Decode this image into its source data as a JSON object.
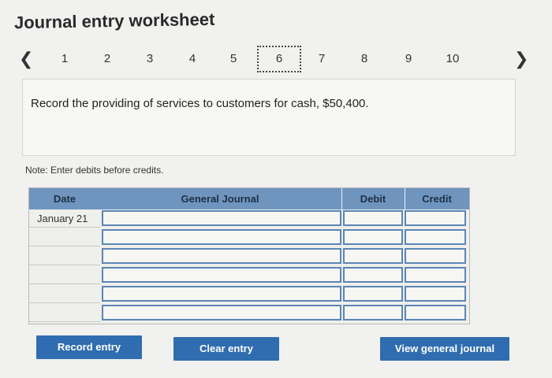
{
  "title": "Journal entry worksheet",
  "pager": {
    "prev_icon": "chevron-left-icon",
    "next_icon": "chevron-right-icon",
    "pages": [
      "1",
      "2",
      "3",
      "4",
      "5",
      "6",
      "7",
      "8",
      "9",
      "10"
    ],
    "active_page": "6"
  },
  "question": "Record the providing of services to customers for cash, $50,400.",
  "note": "Note: Enter debits before credits.",
  "journal": {
    "headers": {
      "date": "Date",
      "general_journal": "General Journal",
      "debit": "Debit",
      "credit": "Credit"
    },
    "rows": [
      {
        "date": "January 21",
        "account": "",
        "debit": "",
        "credit": ""
      },
      {
        "date": "",
        "account": "",
        "debit": "",
        "credit": ""
      },
      {
        "date": "",
        "account": "",
        "debit": "",
        "credit": ""
      },
      {
        "date": "",
        "account": "",
        "debit": "",
        "credit": ""
      },
      {
        "date": "",
        "account": "",
        "debit": "",
        "credit": ""
      },
      {
        "date": "",
        "account": "",
        "debit": "",
        "credit": ""
      }
    ]
  },
  "buttons": {
    "record": "Record entry",
    "clear": "Clear entry",
    "view": "View general journal"
  },
  "colors": {
    "header_bg": "#6f95bf",
    "button_bg": "#2f6db0",
    "input_border": "#5b86b5"
  }
}
